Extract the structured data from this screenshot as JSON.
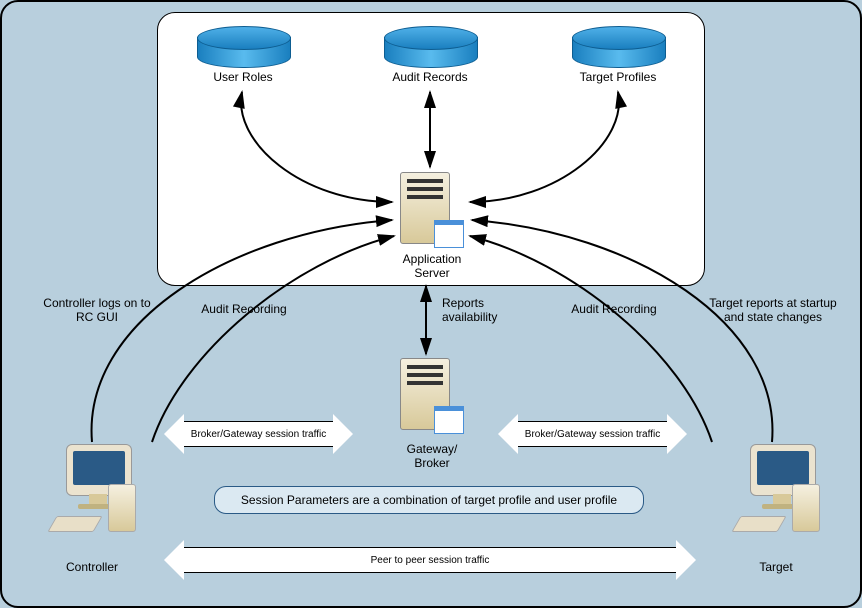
{
  "databases": {
    "user_roles": "User Roles",
    "audit_records": "Audit Records",
    "target_profiles": "Target Profiles"
  },
  "servers": {
    "app_server": "Application\nServer",
    "gateway": "Gateway/\nBroker"
  },
  "endpoints": {
    "controller": "Controller",
    "target": "Target"
  },
  "edges": {
    "controller_logs": "Controller logs on to\nRC GUI",
    "audit_recording_left": "Audit Recording",
    "reports_avail": "Reports\navailability",
    "audit_recording_right": "Audit Recording",
    "target_reports": "Target reports at startup\nand state changes"
  },
  "block_arrows": {
    "broker_left": "Broker/Gateway session traffic",
    "broker_right": "Broker/Gateway session traffic",
    "peer": "Peer to peer session traffic"
  },
  "param_box": "Session Parameters are a combination of target profile and\nuser profile"
}
